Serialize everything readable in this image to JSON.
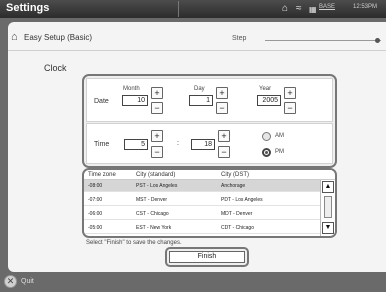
{
  "window": {
    "title": "Settings"
  },
  "status": {
    "network_label": "BASE",
    "time": "12:53PM"
  },
  "header": {
    "title": "Easy Setup (Basic)",
    "step_label": "Step",
    "step_progress": 0.96
  },
  "clock": {
    "section_label": "Clock",
    "date_label": "Date",
    "time_label": "Time",
    "month_label": "Month",
    "day_label": "Day",
    "year_label": "Year",
    "month_value": "10",
    "day_value": "1",
    "year_value": "2005",
    "hour_value": "5",
    "minute_value": "18",
    "separator": ":",
    "plus": "+",
    "minus": "−",
    "am_label": "AM",
    "pm_label": "PM",
    "selected_period": "PM"
  },
  "timezone": {
    "headers": [
      "Time zone",
      "City (standard)",
      "City (DST)"
    ],
    "rows": [
      {
        "zone": "-08:00",
        "std": "PST - Los Angeles",
        "dst": "Anchorage"
      },
      {
        "zone": "-07:00",
        "std": "MST - Denver",
        "dst": "PDT - Los Angeles"
      },
      {
        "zone": "-06:00",
        "std": "CST - Chicago",
        "dst": "MDT - Denver"
      },
      {
        "zone": "-05:00",
        "std": "EST - New York",
        "dst": "CDT - Chicago"
      }
    ],
    "selected_index": 0,
    "scroll_up": "▲",
    "scroll_down": "▼"
  },
  "footer": {
    "hint": "Select \"Finish\" to save the changes.",
    "finish_label": "Finish",
    "quit_label": "Quit",
    "quit_glyph": "✕"
  }
}
